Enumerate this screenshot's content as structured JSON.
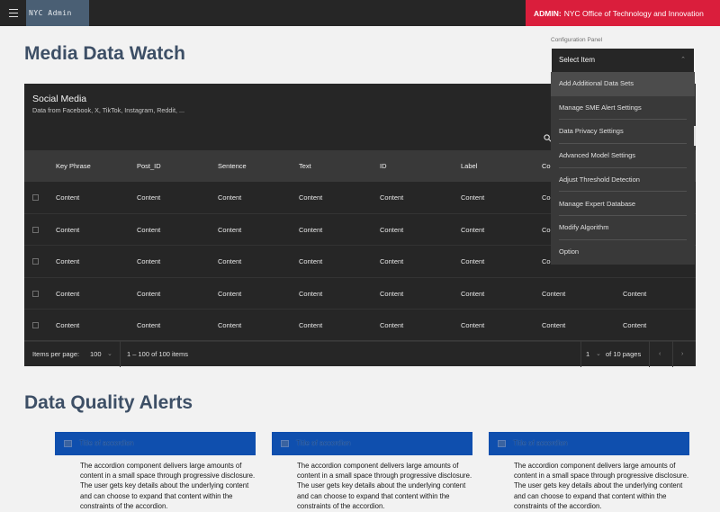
{
  "header": {
    "brand": "NYC Admin",
    "admin_prefix": "ADMIN:",
    "admin_org": "NYC Office of Technology and Innovation"
  },
  "page": {
    "title": "Media Data Watch",
    "dq_title": "Data Quality Alerts"
  },
  "table": {
    "title": "Social Media",
    "subtitle": "Data from Facebook, X, TikTok, Instagram, Reddit, ...",
    "columns": [
      "Key Phrase",
      "Post_ID",
      "Sentence",
      "Text",
      "ID",
      "Label",
      "Co",
      ""
    ],
    "rows": [
      [
        "Content",
        "Content",
        "Content",
        "Content",
        "Content",
        "Content",
        "Co",
        ""
      ],
      [
        "Content",
        "Content",
        "Content",
        "Content",
        "Content",
        "Content",
        "Co",
        ""
      ],
      [
        "Content",
        "Content",
        "Content",
        "Content",
        "Content",
        "Content",
        "Co",
        ""
      ],
      [
        "Content",
        "Content",
        "Content",
        "Content",
        "Content",
        "Content",
        "Content",
        "Content"
      ],
      [
        "Content",
        "Content",
        "Content",
        "Content",
        "Content",
        "Content",
        "Content",
        "Content"
      ]
    ],
    "footer": {
      "items_per_page_label": "Items per page:",
      "items_per_page_value": "100",
      "range_text": "1 – 100 of 100 items",
      "page_value": "1",
      "of_pages": "of 10 pages"
    }
  },
  "config": {
    "label": "Configuration Panel",
    "select_label": "Select Item",
    "options": [
      "Add Additional Data Sets",
      "Manage SME Alert Settings",
      "Data Privacy Settings",
      "Advanced Model Settings",
      "Adjust Threshold Detection",
      "Manage Expert Database",
      "Modify Algorithm",
      "Option"
    ],
    "highlighted_index": 0
  },
  "accordions": [
    {
      "title": "Title of accordion",
      "body": "The accordion component delivers large amounts of content in a small space through progressive disclosure. The user gets key details about the underlying content and can choose to expand that content within the constraints of the accordion."
    },
    {
      "title": "Title of accordion",
      "body": "The accordion component delivers large amounts of content in a small space through progressive disclosure. The user gets key details about the underlying content and can choose to expand that content within the constraints of the accordion."
    },
    {
      "title": "Title of accordion",
      "body": "The accordion component delivers large amounts of content in a small space through progressive disclosure. The user gets key details about the underlying content and can choose to expand that content within the constraints of the accordion."
    }
  ],
  "colors": {
    "topbar": "#262626",
    "admin_bar": "#da1e3c",
    "title_text": "#3d4f66",
    "accordion_header": "#0f4fae"
  },
  "icons": [
    "menu-icon",
    "search-icon",
    "chevron-down-icon",
    "chevron-left-icon",
    "chevron-right-icon",
    "checkbox-icon"
  ]
}
